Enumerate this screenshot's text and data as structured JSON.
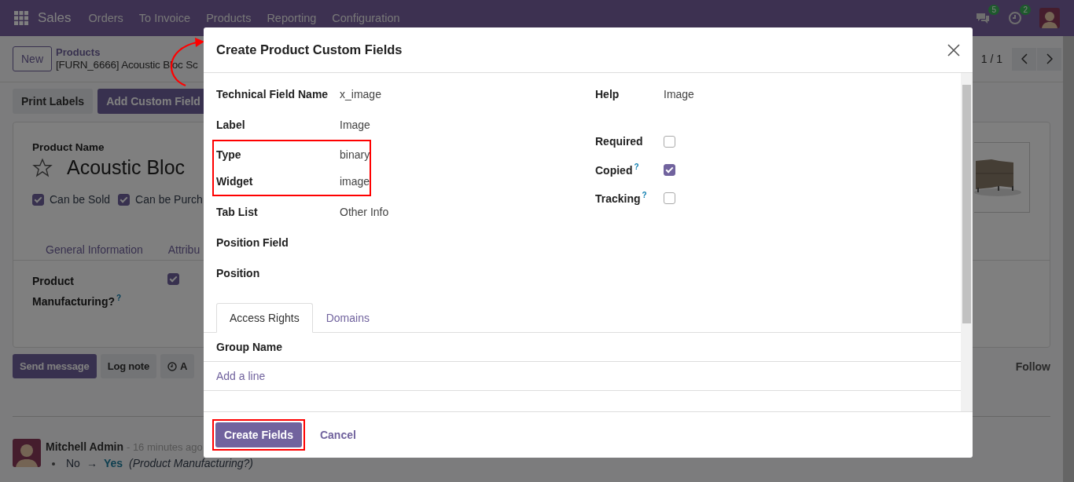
{
  "navbar": {
    "app": "Sales",
    "menu": [
      "Orders",
      "To Invoice",
      "Products",
      "Reporting",
      "Configuration"
    ],
    "messages_badge": "5",
    "activities_badge": "2"
  },
  "control_panel": {
    "new_button": "New",
    "breadcrumb_parent": "Products",
    "breadcrumb_current": "[FURN_6666] Acoustic Bloc Sc",
    "pager": "1 / 1"
  },
  "action_buttons": [
    {
      "label": "Print Labels",
      "kind": "secondary"
    },
    {
      "label": "Add Custom Field",
      "kind": "primary"
    }
  ],
  "form": {
    "name_label": "Product Name",
    "starred": false,
    "title": "Acoustic Bloc",
    "options": [
      {
        "label": "Can be Sold",
        "checked": true
      },
      {
        "label": "Can be Purch",
        "checked": true
      }
    ],
    "tabs": [
      {
        "label": "General Information",
        "selected": false
      },
      {
        "label": "Attribu",
        "selected": false
      }
    ],
    "manufacturing": {
      "label": "Product Manufacturing?",
      "help": "?",
      "checked": true
    }
  },
  "chatter": {
    "buttons": [
      {
        "label": "Send message",
        "kind": "primary"
      },
      {
        "label": "Log note",
        "kind": "secondary"
      },
      {
        "label": "A",
        "kind": "activity"
      }
    ],
    "follow": "Follow",
    "message": {
      "author": "Mitchell Admin",
      "time": "- 16 minutes ago",
      "old": "No",
      "arrow": "→",
      "new": "Yes",
      "field": "(Product Manufacturing?)"
    }
  },
  "dialog": {
    "title": "Create Product Custom Fields",
    "left_fields": [
      {
        "label": "Technical Field Name",
        "value": "x_image",
        "highlighted": false
      },
      {
        "label": "Label",
        "value": "Image",
        "highlighted": false
      },
      {
        "label": "Type",
        "value": "binary",
        "highlighted": true
      },
      {
        "label": "Widget",
        "value": "image",
        "highlighted": true
      },
      {
        "label": "Tab List",
        "value": "Other Info",
        "highlighted": false
      },
      {
        "label": "Position Field",
        "highlighted": false
      },
      {
        "label": "Position",
        "highlighted": false
      }
    ],
    "right_fields": [
      {
        "kind": "text",
        "label": "Help",
        "value": "Image"
      },
      {
        "kind": "checkbox",
        "label": "Required",
        "checked": false
      },
      {
        "kind": "checkbox",
        "label": "Copied",
        "help": "?",
        "checked": true
      },
      {
        "kind": "checkbox",
        "label": "Tracking",
        "help": "?",
        "checked": false
      }
    ],
    "tabs": [
      {
        "label": "Access Rights",
        "selected": true
      },
      {
        "label": "Domains",
        "selected": false
      }
    ],
    "table": {
      "columns": [
        "Group Name"
      ],
      "add_line": "Add a line"
    },
    "buttons": [
      {
        "label": "Create Fields",
        "kind": "primary",
        "highlighted": true
      },
      {
        "label": "Cancel",
        "kind": "link",
        "highlighted": false
      }
    ]
  }
}
